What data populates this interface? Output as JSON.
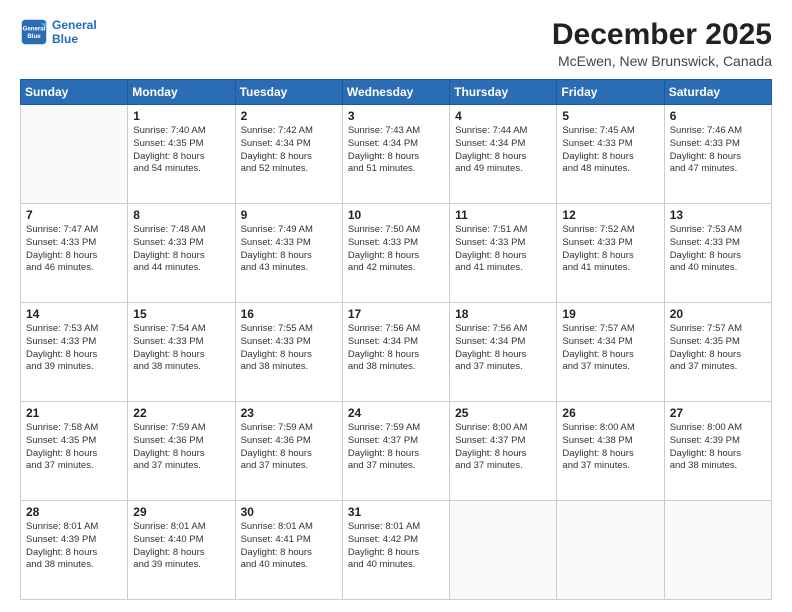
{
  "logo": {
    "line1": "General",
    "line2": "Blue"
  },
  "title": "December 2025",
  "subtitle": "McEwen, New Brunswick, Canada",
  "days_of_week": [
    "Sunday",
    "Monday",
    "Tuesday",
    "Wednesday",
    "Thursday",
    "Friday",
    "Saturday"
  ],
  "weeks": [
    [
      {
        "day": "",
        "info": ""
      },
      {
        "day": "1",
        "info": "Sunrise: 7:40 AM\nSunset: 4:35 PM\nDaylight: 8 hours\nand 54 minutes."
      },
      {
        "day": "2",
        "info": "Sunrise: 7:42 AM\nSunset: 4:34 PM\nDaylight: 8 hours\nand 52 minutes."
      },
      {
        "day": "3",
        "info": "Sunrise: 7:43 AM\nSunset: 4:34 PM\nDaylight: 8 hours\nand 51 minutes."
      },
      {
        "day": "4",
        "info": "Sunrise: 7:44 AM\nSunset: 4:34 PM\nDaylight: 8 hours\nand 49 minutes."
      },
      {
        "day": "5",
        "info": "Sunrise: 7:45 AM\nSunset: 4:33 PM\nDaylight: 8 hours\nand 48 minutes."
      },
      {
        "day": "6",
        "info": "Sunrise: 7:46 AM\nSunset: 4:33 PM\nDaylight: 8 hours\nand 47 minutes."
      }
    ],
    [
      {
        "day": "7",
        "info": "Sunrise: 7:47 AM\nSunset: 4:33 PM\nDaylight: 8 hours\nand 46 minutes."
      },
      {
        "day": "8",
        "info": "Sunrise: 7:48 AM\nSunset: 4:33 PM\nDaylight: 8 hours\nand 44 minutes."
      },
      {
        "day": "9",
        "info": "Sunrise: 7:49 AM\nSunset: 4:33 PM\nDaylight: 8 hours\nand 43 minutes."
      },
      {
        "day": "10",
        "info": "Sunrise: 7:50 AM\nSunset: 4:33 PM\nDaylight: 8 hours\nand 42 minutes."
      },
      {
        "day": "11",
        "info": "Sunrise: 7:51 AM\nSunset: 4:33 PM\nDaylight: 8 hours\nand 41 minutes."
      },
      {
        "day": "12",
        "info": "Sunrise: 7:52 AM\nSunset: 4:33 PM\nDaylight: 8 hours\nand 41 minutes."
      },
      {
        "day": "13",
        "info": "Sunrise: 7:53 AM\nSunset: 4:33 PM\nDaylight: 8 hours\nand 40 minutes."
      }
    ],
    [
      {
        "day": "14",
        "info": "Sunrise: 7:53 AM\nSunset: 4:33 PM\nDaylight: 8 hours\nand 39 minutes."
      },
      {
        "day": "15",
        "info": "Sunrise: 7:54 AM\nSunset: 4:33 PM\nDaylight: 8 hours\nand 38 minutes."
      },
      {
        "day": "16",
        "info": "Sunrise: 7:55 AM\nSunset: 4:33 PM\nDaylight: 8 hours\nand 38 minutes."
      },
      {
        "day": "17",
        "info": "Sunrise: 7:56 AM\nSunset: 4:34 PM\nDaylight: 8 hours\nand 38 minutes."
      },
      {
        "day": "18",
        "info": "Sunrise: 7:56 AM\nSunset: 4:34 PM\nDaylight: 8 hours\nand 37 minutes."
      },
      {
        "day": "19",
        "info": "Sunrise: 7:57 AM\nSunset: 4:34 PM\nDaylight: 8 hours\nand 37 minutes."
      },
      {
        "day": "20",
        "info": "Sunrise: 7:57 AM\nSunset: 4:35 PM\nDaylight: 8 hours\nand 37 minutes."
      }
    ],
    [
      {
        "day": "21",
        "info": "Sunrise: 7:58 AM\nSunset: 4:35 PM\nDaylight: 8 hours\nand 37 minutes."
      },
      {
        "day": "22",
        "info": "Sunrise: 7:59 AM\nSunset: 4:36 PM\nDaylight: 8 hours\nand 37 minutes."
      },
      {
        "day": "23",
        "info": "Sunrise: 7:59 AM\nSunset: 4:36 PM\nDaylight: 8 hours\nand 37 minutes."
      },
      {
        "day": "24",
        "info": "Sunrise: 7:59 AM\nSunset: 4:37 PM\nDaylight: 8 hours\nand 37 minutes."
      },
      {
        "day": "25",
        "info": "Sunrise: 8:00 AM\nSunset: 4:37 PM\nDaylight: 8 hours\nand 37 minutes."
      },
      {
        "day": "26",
        "info": "Sunrise: 8:00 AM\nSunset: 4:38 PM\nDaylight: 8 hours\nand 37 minutes."
      },
      {
        "day": "27",
        "info": "Sunrise: 8:00 AM\nSunset: 4:39 PM\nDaylight: 8 hours\nand 38 minutes."
      }
    ],
    [
      {
        "day": "28",
        "info": "Sunrise: 8:01 AM\nSunset: 4:39 PM\nDaylight: 8 hours\nand 38 minutes."
      },
      {
        "day": "29",
        "info": "Sunrise: 8:01 AM\nSunset: 4:40 PM\nDaylight: 8 hours\nand 39 minutes."
      },
      {
        "day": "30",
        "info": "Sunrise: 8:01 AM\nSunset: 4:41 PM\nDaylight: 8 hours\nand 40 minutes."
      },
      {
        "day": "31",
        "info": "Sunrise: 8:01 AM\nSunset: 4:42 PM\nDaylight: 8 hours\nand 40 minutes."
      },
      {
        "day": "",
        "info": ""
      },
      {
        "day": "",
        "info": ""
      },
      {
        "day": "",
        "info": ""
      }
    ]
  ]
}
